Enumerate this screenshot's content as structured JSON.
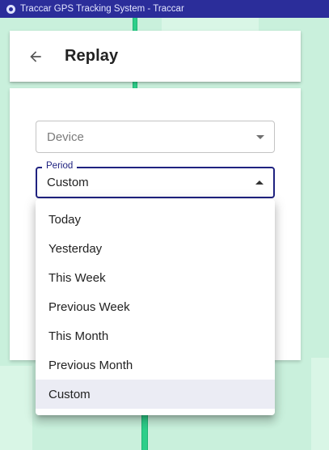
{
  "window": {
    "title": "Traccar GPS Tracking System - Traccar",
    "icon": "traccar-app-icon"
  },
  "header": {
    "back_icon": "arrow-left-icon",
    "title": "Replay"
  },
  "form": {
    "device": {
      "placeholder": "Device",
      "value": ""
    },
    "period": {
      "label": "Period",
      "value": "Custom"
    }
  },
  "period_menu": {
    "options": [
      "Today",
      "Yesterday",
      "This Week",
      "Previous Week",
      "This Month",
      "Previous Month",
      "Custom"
    ],
    "selected": "Custom"
  },
  "colors": {
    "titlebar": "#2b2d9a",
    "accent": "#1f2280",
    "map_background": "#c9f0dc",
    "route": "#2dcf8a",
    "selected_item": "#ebecf4"
  }
}
